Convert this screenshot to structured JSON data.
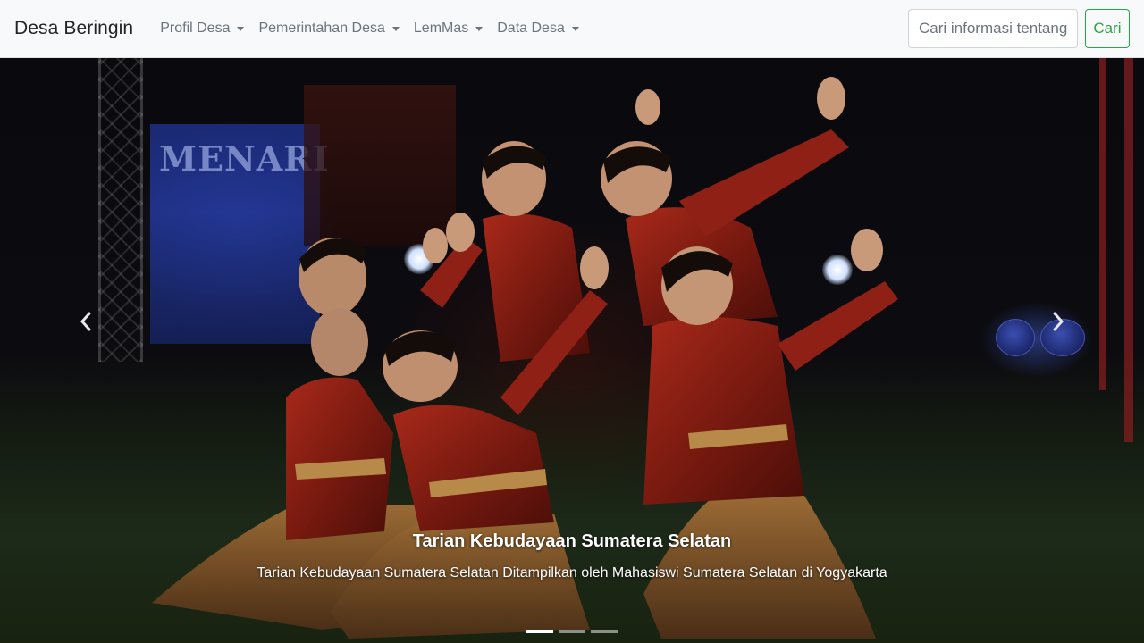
{
  "navbar": {
    "brand": "Desa Beringin",
    "menu": [
      {
        "label": "Profil Desa"
      },
      {
        "label": "Pemerintahan Desa"
      },
      {
        "label": "LemMas"
      },
      {
        "label": "Data Desa"
      }
    ],
    "search": {
      "placeholder": "Cari informasi tentang",
      "button_label": "Cari"
    }
  },
  "carousel": {
    "backdrop_sign": "MENARI",
    "caption_title": "Tarian Kebudayaan Sumatera Selatan",
    "caption_text": "Tarian Kebudayaan Sumatera Selatan Ditampilkan oleh Mahasiswi Sumatera Selatan di Yogyakarta",
    "indicators": [
      {
        "active": true
      },
      {
        "active": false
      },
      {
        "active": false
      }
    ]
  },
  "colors": {
    "navbar_bg": "#f8f9fa",
    "nav_link": "#6c757d",
    "search_button": "#28a745",
    "costume_red": "#8a1f14",
    "costume_gold": "#a8743a"
  }
}
